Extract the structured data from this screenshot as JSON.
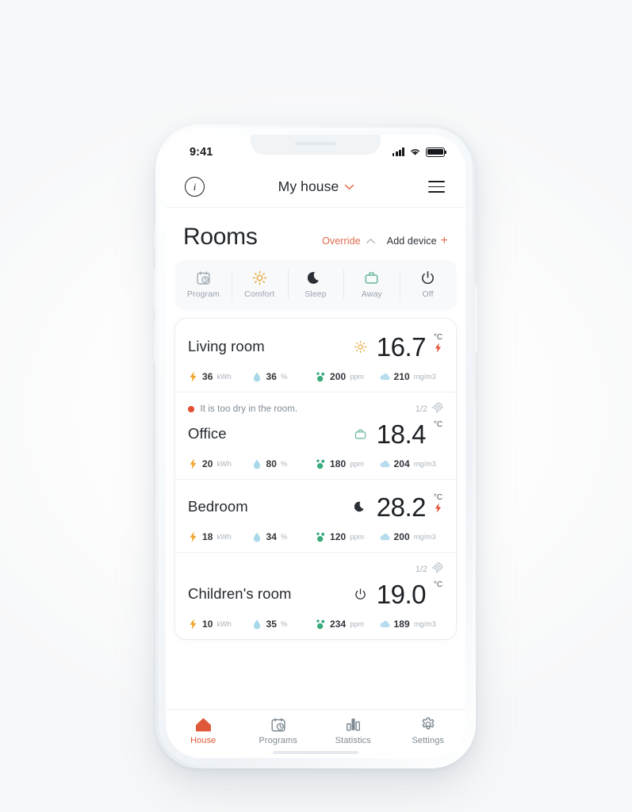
{
  "status_bar": {
    "time": "9:41",
    "signal_icon": "cellular-signal-icon",
    "wifi_icon": "wifi-icon",
    "battery_icon": "battery-full-icon"
  },
  "nav": {
    "info_icon": "info-icon",
    "info_glyph": "i",
    "title": "My house",
    "chevron_icon": "chevron-down-icon",
    "menu_icon": "hamburger-menu-icon"
  },
  "header": {
    "title": "Rooms",
    "override_label": "Override",
    "override_chevron_icon": "chevron-up-icon",
    "add_device_label": "Add device",
    "add_device_plus": "+"
  },
  "modes": [
    {
      "label": "Program",
      "icon": "calendar-clock-icon",
      "color": "#9aa4ad"
    },
    {
      "label": "Comfort",
      "icon": "sun-icon",
      "color": "#e8a83a"
    },
    {
      "label": "Sleep",
      "icon": "moon-icon",
      "color": "#2b3036"
    },
    {
      "label": "Away",
      "icon": "briefcase-icon",
      "color": "#66b596"
    },
    {
      "label": "Off",
      "icon": "power-icon",
      "color": "#2b3036"
    }
  ],
  "rooms": [
    {
      "name": "Living room",
      "mode_icon": "sun-icon",
      "mode_icon_color": "#e8a83a",
      "temperature": "16.7",
      "unit": "°C",
      "heating_icon": "lightning-bolt-icon",
      "heating_active": true,
      "alert": null,
      "sensor_count": null,
      "metrics": [
        {
          "icon": "lightning-bolt-icon",
          "value": "36",
          "unit": "kWh"
        },
        {
          "icon": "water-drop-icon",
          "value": "36",
          "unit": "%"
        },
        {
          "icon": "co2-molecule-icon",
          "value": "200",
          "unit": "ppm"
        },
        {
          "icon": "cloud-icon",
          "value": "210",
          "unit": "mg/m3"
        }
      ]
    },
    {
      "name": "Office",
      "mode_icon": "briefcase-icon",
      "mode_icon_color": "#66b596",
      "temperature": "18.4",
      "unit": "°C",
      "heating_icon": null,
      "heating_active": false,
      "alert": "It is too dry in the room.",
      "sensor_count": "1/2",
      "sensor_icon": "signal-arcs-icon",
      "metrics": [
        {
          "icon": "lightning-bolt-icon",
          "value": "20",
          "unit": "kWh"
        },
        {
          "icon": "water-drop-icon",
          "value": "80",
          "unit": "%"
        },
        {
          "icon": "co2-molecule-icon",
          "value": "180",
          "unit": "ppm"
        },
        {
          "icon": "cloud-icon",
          "value": "204",
          "unit": "mg/m3"
        }
      ]
    },
    {
      "name": "Bedroom",
      "mode_icon": "moon-icon",
      "mode_icon_color": "#2b3036",
      "temperature": "28.2",
      "unit": "°C",
      "heating_icon": "lightning-bolt-icon",
      "heating_active": true,
      "alert": null,
      "sensor_count": null,
      "metrics": [
        {
          "icon": "lightning-bolt-icon",
          "value": "18",
          "unit": "kWh"
        },
        {
          "icon": "water-drop-icon",
          "value": "34",
          "unit": "%"
        },
        {
          "icon": "co2-molecule-icon",
          "value": "120",
          "unit": "ppm"
        },
        {
          "icon": "cloud-icon",
          "value": "200",
          "unit": "mg/m3"
        }
      ]
    },
    {
      "name": "Children's room",
      "mode_icon": "power-icon",
      "mode_icon_color": "#2b3036",
      "temperature": "19.0",
      "unit": "°C",
      "heating_icon": null,
      "heating_active": false,
      "alert": null,
      "sensor_count": "1/2",
      "sensor_icon": "signal-arcs-icon",
      "metrics": [
        {
          "icon": "lightning-bolt-icon",
          "value": "10",
          "unit": "kWh"
        },
        {
          "icon": "water-drop-icon",
          "value": "35",
          "unit": "%"
        },
        {
          "icon": "co2-molecule-icon",
          "value": "234",
          "unit": "ppm"
        },
        {
          "icon": "cloud-icon",
          "value": "189",
          "unit": "mg/m3"
        }
      ]
    }
  ],
  "tabs": [
    {
      "label": "House",
      "icon": "home-icon",
      "active": true
    },
    {
      "label": "Programs",
      "icon": "calendar-clock-icon",
      "active": false
    },
    {
      "label": "Statistics",
      "icon": "bar-chart-icon",
      "active": false
    },
    {
      "label": "Settings",
      "icon": "gear-icon",
      "active": false
    }
  ],
  "colors": {
    "accent": "#e0583a",
    "override": "#dd6a4c",
    "alert_dot": "#e24f32",
    "sun": "#e8a83a",
    "away_green": "#66b596",
    "drop_blue": "#a8d8ea",
    "co2_green": "#3aab7d",
    "cloud_blue": "#b7dced",
    "bolt_amber": "#f0a42a"
  }
}
